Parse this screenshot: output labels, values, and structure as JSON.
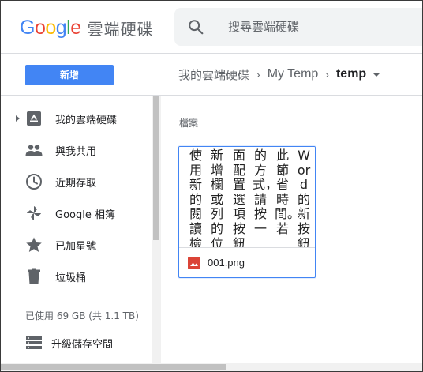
{
  "header": {
    "logo_text": "Google",
    "logo_letters": [
      "G",
      "o",
      "o",
      "g",
      "l",
      "e"
    ],
    "logo_colors": [
      "#4285f4",
      "#ea4335",
      "#fbbc05",
      "#4285f4",
      "#34a853",
      "#ea4335"
    ],
    "product_name": "雲端硬碟",
    "search_placeholder": "搜尋雲端硬碟",
    "search_icon": "search-icon"
  },
  "toolbar": {
    "new_label": "新增",
    "new_button_color": "#4285f4",
    "breadcrumb": [
      "我的雲端硬碟",
      "My Temp",
      "temp"
    ]
  },
  "sidebar": {
    "items": [
      {
        "label": "我的雲端硬碟",
        "icon": "drive-icon",
        "expandable": true
      },
      {
        "label": "與我共用",
        "icon": "people-icon"
      },
      {
        "label": "近期存取",
        "icon": "clock-icon"
      },
      {
        "label": "Google 相簿",
        "icon": "photos-pinwheel-icon"
      },
      {
        "label": "已加星號",
        "icon": "star-icon"
      },
      {
        "label": "垃圾桶",
        "icon": "trash-icon"
      }
    ],
    "storage_text": "已使用 69 GB (共 1.1 TB)",
    "upgrade_label": "升級儲存空間",
    "upgrade_icon": "storage-icon"
  },
  "main": {
    "section_label": "檔案",
    "files": [
      {
        "name": "001.png",
        "icon": "image-file-icon",
        "icon_color": "#db4437",
        "preview_columns": [
          "Word的新按鈕",
          "此節省時間。若",
          "的方式，請按一",
          "面配置選項按鈕",
          "新增欄或列的位",
          "使用新的閱讀檢"
        ]
      }
    ]
  }
}
